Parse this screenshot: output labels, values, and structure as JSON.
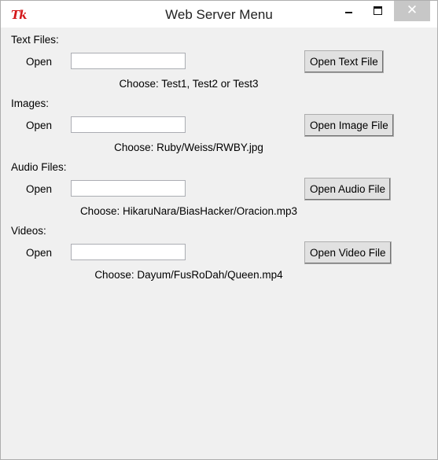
{
  "window": {
    "title": "Web Server Menu",
    "icon_text": "Tk",
    "close_glyph": "✕"
  },
  "sections": [
    {
      "label": "Text Files:",
      "open_label": "Open",
      "input_value": "",
      "button_label": "Open Text File",
      "hint": "Choose: Test1, Test2 or Test3"
    },
    {
      "label": "Images:",
      "open_label": "Open",
      "input_value": "",
      "button_label": "Open Image File",
      "hint": "Choose: Ruby/Weiss/RWBY.jpg"
    },
    {
      "label": "Audio Files:",
      "open_label": "Open",
      "input_value": "",
      "button_label": "Open Audio File",
      "hint": "Choose: HikaruNara/BiasHacker/Oracion.mp3"
    },
    {
      "label": "Videos:",
      "open_label": "Open",
      "input_value": "",
      "button_label": "Open Video File",
      "hint": "Choose: Dayum/FusRoDah/Queen.mp4"
    }
  ]
}
